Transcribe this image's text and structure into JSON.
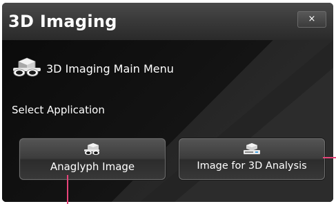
{
  "dialog": {
    "title": "3D Imaging",
    "close_label": "×",
    "menu_icon": "3d-glasses-icon",
    "menu_title": "3D Imaging Main Menu",
    "select_label": "Select Application",
    "buttons": [
      {
        "label": "Anaglyph Image",
        "icon": "3d-glasses-icon"
      },
      {
        "label": "Image for 3D Analysis",
        "icon": "3d-scanner-icon"
      }
    ]
  },
  "colors": {
    "title_bar": "#3a3a3a",
    "background": "#101010",
    "button": "#3c3c3c",
    "text": "#ffffff",
    "callout": "#e8447a"
  }
}
